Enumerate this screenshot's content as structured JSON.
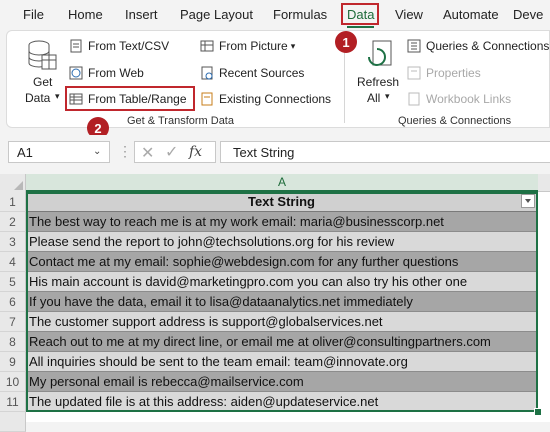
{
  "menu": {
    "tabs": [
      {
        "label": "File"
      },
      {
        "label": "Home"
      },
      {
        "label": "Insert"
      },
      {
        "label": "Page Layout"
      },
      {
        "label": "Formulas"
      },
      {
        "label": "Data"
      },
      {
        "label": "View"
      },
      {
        "label": "Automate"
      },
      {
        "label": "Deve"
      }
    ],
    "active_tab": "Data"
  },
  "ribbon": {
    "get_data": {
      "line1": "Get",
      "line2": "Data"
    },
    "get_transform": {
      "from_text_csv": "From Text/CSV",
      "from_web": "From Web",
      "from_table_range": "From Table/Range",
      "from_picture": "From Picture",
      "recent_sources": "Recent Sources",
      "existing_connections": "Existing Connections",
      "group_label": "Get & Transform Data"
    },
    "queries": {
      "refresh_all_line1": "Refresh",
      "refresh_all_line2": "All",
      "queries_connections": "Queries & Connections",
      "properties": "Properties",
      "workbook_links": "Workbook Links",
      "group_label": "Queries & Connections"
    }
  },
  "callouts": {
    "step1": "1",
    "step2": "2"
  },
  "formula_bar": {
    "name_box": "A1",
    "fx": "fx",
    "formula": "Text String"
  },
  "sheet": {
    "column_header": "A",
    "rows": [
      {
        "num": "1",
        "text": "Text String"
      },
      {
        "num": "2",
        "text": "The best way to reach me is at my work email: maria@businesscorp.net"
      },
      {
        "num": "3",
        "text": "Please send the report to john@techsolutions.org for his review"
      },
      {
        "num": "4",
        "text": "Contact me at my email: sophie@webdesign.com for any further questions"
      },
      {
        "num": "5",
        "text": "His main account is david@marketingpro.com you can also try his other one"
      },
      {
        "num": "6",
        "text": "If you have the data, email it to lisa@dataanalytics.net immediately"
      },
      {
        "num": "7",
        "text": "The customer support address is support@globalservices.net"
      },
      {
        "num": "8",
        "text": "Reach out to me at my direct line, or email me at oliver@consultingpartners.com"
      },
      {
        "num": "9",
        "text": "All inquiries should be sent to the team email: team@innovate.org"
      },
      {
        "num": "10",
        "text": "My personal email is rebecca@mailservice.com"
      },
      {
        "num": "11",
        "text": "The updated file is at this address: aiden@updateservice.net"
      }
    ]
  },
  "colors": {
    "accent": "#1e7145",
    "callout": "#b21f24",
    "band_dark": "#a6a6a6",
    "band_light": "#d9d9d9",
    "header": "#d0d0d0"
  }
}
